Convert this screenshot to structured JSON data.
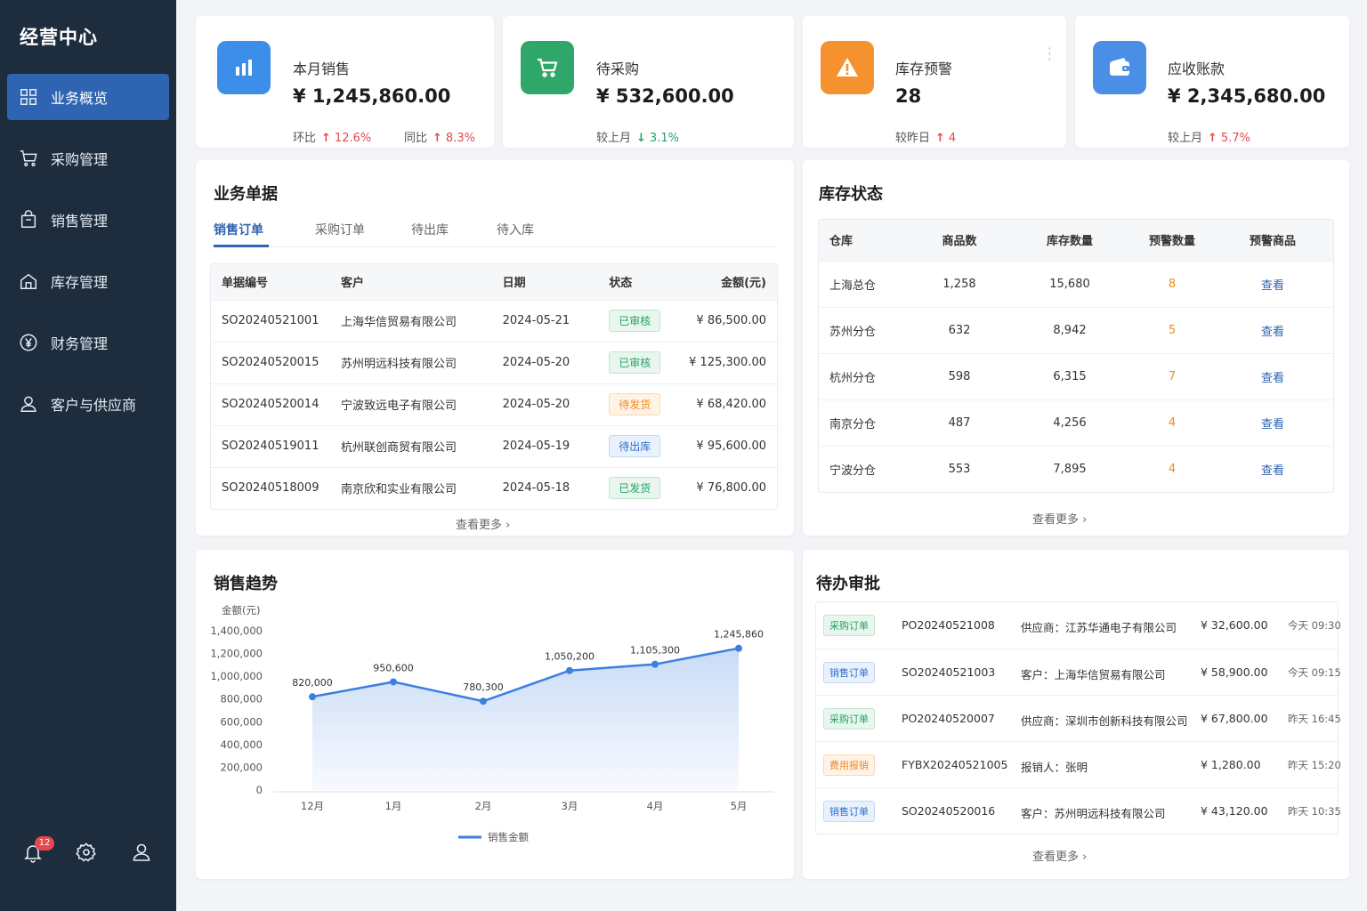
{
  "sidebar": {
    "brand": "经营中心",
    "items": [
      {
        "label": "业务概览",
        "icon": "grid-icon",
        "active": true
      },
      {
        "label": "采购管理",
        "icon": "cart-icon"
      },
      {
        "label": "销售管理",
        "icon": "bag-icon"
      },
      {
        "label": "库存管理",
        "icon": "home-icon"
      },
      {
        "label": "财务管理",
        "icon": "yen-icon"
      },
      {
        "label": "客户与供应商",
        "icon": "user-icon"
      }
    ],
    "notification_count": "12"
  },
  "kpis": [
    {
      "title": "本月销售",
      "value": "¥ 1,245,860.00",
      "icon": "bar-chart-icon",
      "color": "#3d8ee8",
      "subs": [
        {
          "label": "环比",
          "dir": "up",
          "value": "12.6%"
        },
        {
          "label": "同比",
          "dir": "up",
          "value": "8.3%"
        }
      ]
    },
    {
      "title": "待采购",
      "value": "¥ 532,600.00",
      "icon": "cart-icon",
      "color": "#2fa76a",
      "subs": [
        {
          "label": "较上月",
          "dir": "down",
          "value": "3.1%"
        }
      ]
    },
    {
      "title": "库存预警",
      "value": "28",
      "icon": "warning-icon",
      "color": "#f5922f",
      "subs": [
        {
          "label": "较昨日",
          "dir": "up",
          "value": "4"
        }
      ]
    },
    {
      "title": "应收账款",
      "value": "¥ 2,345,680.00",
      "icon": "wallet-icon",
      "color": "#4a8ee6",
      "subs": [
        {
          "label": "较上月",
          "dir": "up",
          "value": "5.7%"
        }
      ]
    }
  ],
  "orders": {
    "title": "业务单据",
    "tabs": [
      "销售订单",
      "采购订单",
      "待出库",
      "待入库"
    ],
    "columns": [
      "单据编号",
      "客户",
      "日期",
      "状态",
      "金额(元)"
    ],
    "rows": [
      {
        "id": "SO20240521001",
        "customer": "上海华信贸易有限公司",
        "date": "2024-05-21",
        "status": "已审核",
        "status_type": "green",
        "amount": "¥ 86,500.00"
      },
      {
        "id": "SO20240520015",
        "customer": "苏州明远科技有限公司",
        "date": "2024-05-20",
        "status": "已审核",
        "status_type": "green",
        "amount": "¥ 125,300.00"
      },
      {
        "id": "SO20240520014",
        "customer": "宁波致远电子有限公司",
        "date": "2024-05-20",
        "status": "待发货",
        "status_type": "orange",
        "amount": "¥ 68,420.00"
      },
      {
        "id": "SO20240519011",
        "customer": "杭州联创商贸有限公司",
        "date": "2024-05-19",
        "status": "待出库",
        "status_type": "blue",
        "amount": "¥ 95,600.00"
      },
      {
        "id": "SO20240518009",
        "customer": "南京欣和实业有限公司",
        "date": "2024-05-18",
        "status": "已发货",
        "status_type": "green",
        "amount": "¥ 76,800.00"
      }
    ],
    "more": "查看更多"
  },
  "inventory": {
    "title": "库存状态",
    "columns": [
      "仓库",
      "商品数",
      "库存数量",
      "预警数量",
      "预警商品"
    ],
    "rows": [
      {
        "warehouse": "上海总仓",
        "products": "1,258",
        "stock": "15,680",
        "warn": "8",
        "action": "查看"
      },
      {
        "warehouse": "苏州分仓",
        "products": "632",
        "stock": "8,942",
        "warn": "5",
        "action": "查看"
      },
      {
        "warehouse": "杭州分仓",
        "products": "598",
        "stock": "6,315",
        "warn": "7",
        "action": "查看"
      },
      {
        "warehouse": "南京分仓",
        "products": "487",
        "stock": "4,256",
        "warn": "4",
        "action": "查看"
      },
      {
        "warehouse": "宁波分仓",
        "products": "553",
        "stock": "7,895",
        "warn": "4",
        "action": "查看"
      }
    ],
    "more": "查看更多"
  },
  "trend": {
    "title": "销售趋势"
  },
  "chart_data": {
    "type": "area",
    "title": "销售趋势",
    "ylabel": "金额(元)",
    "categories": [
      "12月",
      "1月",
      "2月",
      "3月",
      "4月",
      "5月"
    ],
    "series": [
      {
        "name": "销售金额",
        "values": [
          820000,
          950600,
          780300,
          1050200,
          1105300,
          1245860
        ],
        "labels": [
          "820,000",
          "950,600",
          "780,300",
          "1,050,200",
          "1,105,300",
          "1,245,860"
        ],
        "color": "#3b7fe0"
      }
    ],
    "ylim": [
      0,
      1400000
    ],
    "yticks": [
      "0",
      "200,000",
      "400,000",
      "600,000",
      "800,000",
      "1,000,000",
      "1,200,000",
      "1,400,000"
    ],
    "legend": "bottom-center",
    "grid": false
  },
  "approvals": {
    "title": "待办审批",
    "rows": [
      {
        "tag": "采购订单",
        "tag_type": "green",
        "id": "PO20240521008",
        "party": "供应商：江苏华通电子有限公司",
        "amount": "¥ 32,600.00",
        "time": "今天 09:30"
      },
      {
        "tag": "销售订单",
        "tag_type": "blue",
        "id": "SO20240521003",
        "party": "客户：上海华信贸易有限公司",
        "amount": "¥ 58,900.00",
        "time": "今天 09:15"
      },
      {
        "tag": "采购订单",
        "tag_type": "green",
        "id": "PO20240520007",
        "party": "供应商：深圳市创新科技有限公司",
        "amount": "¥ 67,800.00",
        "time": "昨天 16:45"
      },
      {
        "tag": "费用报销",
        "tag_type": "orange",
        "id": "FYBX20240521005",
        "party": "报销人：张明",
        "amount": "¥ 1,280.00",
        "time": "昨天 15:20"
      },
      {
        "tag": "销售订单",
        "tag_type": "blue",
        "id": "SO20240520016",
        "party": "客户：苏州明远科技有限公司",
        "amount": "¥ 43,120.00",
        "time": "昨天 10:35"
      }
    ],
    "more": "查看更多"
  }
}
